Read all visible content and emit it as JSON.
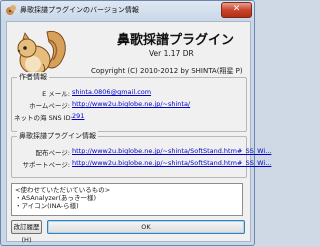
{
  "window": {
    "title": "鼻歌採譜プラグインのバージョン情報",
    "close_label": "✕"
  },
  "header": {
    "app_name": "鼻歌採譜プラグイン",
    "version": "Ver 1.17 DR",
    "copyright": "Copyright (C) 2010-2012 by SHINTA(翔星 P)"
  },
  "author_info": {
    "legend": "作者情報",
    "rows": [
      {
        "label": "E メール:",
        "value": "shinta.0806@gmail.com"
      },
      {
        "label": "ホームページ:",
        "value": "http://www2u.biglobe.ne.jp/~shinta/"
      },
      {
        "label": "ネットの海 SNS ID:",
        "value": "291"
      }
    ]
  },
  "distribution_info": {
    "legend": "鼻歌採譜プラグイン情報",
    "rows": [
      {
        "label": "配布ページ:",
        "value": "http://www2u.biglobe.ne.jp/~shinta/SoftStand.htm#_SS_Wi..."
      },
      {
        "label": "サポートページ:",
        "value": "http://www2u.biglobe.ne.jp/~shinta/SoftStand.htm#_SS_Wi..."
      }
    ]
  },
  "credits": {
    "lines": [
      "<使わせていただいているもの>",
      "・ASAnalyzer(あっき一様)",
      "・アイコン(INA-ら様)"
    ]
  },
  "buttons": {
    "history": "改訂履歴(H)",
    "ok": "OK"
  }
}
